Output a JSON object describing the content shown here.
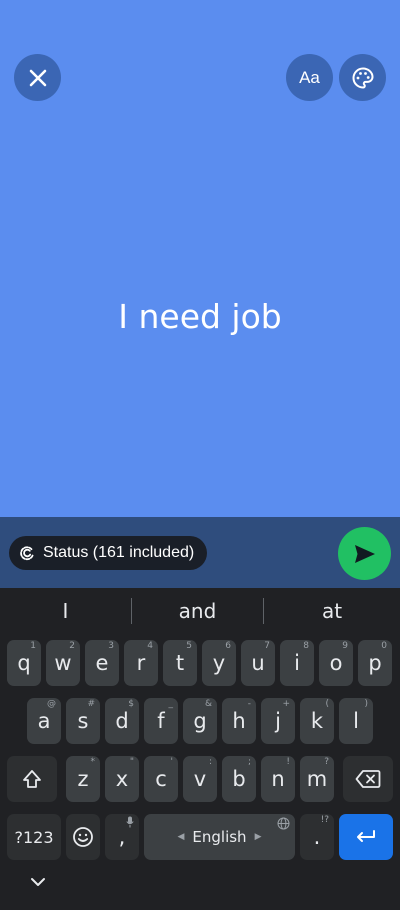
{
  "status_editor": {
    "text": "I need job",
    "background_color": "#5b8def",
    "font_button_label": "Aa",
    "audience_label": "Status (161 included)"
  },
  "icons": {
    "close": "close-icon",
    "palette": "palette-icon",
    "audience": "status-icon",
    "send": "send-icon",
    "shift": "shift-icon",
    "backspace": "backspace-icon",
    "emoji": "emoji-icon",
    "mic": "mic-icon",
    "globe": "globe-icon",
    "enter": "enter-icon",
    "collapse": "chevron-down-icon"
  },
  "keyboard": {
    "suggestions": [
      "I",
      "and",
      "at"
    ],
    "row1": [
      {
        "k": "q",
        "h": "1"
      },
      {
        "k": "w",
        "h": "2"
      },
      {
        "k": "e",
        "h": "3"
      },
      {
        "k": "r",
        "h": "4"
      },
      {
        "k": "t",
        "h": "5"
      },
      {
        "k": "y",
        "h": "6"
      },
      {
        "k": "u",
        "h": "7"
      },
      {
        "k": "i",
        "h": "8"
      },
      {
        "k": "o",
        "h": "9"
      },
      {
        "k": "p",
        "h": "0"
      }
    ],
    "row2": [
      {
        "k": "a",
        "h": "@"
      },
      {
        "k": "s",
        "h": "#"
      },
      {
        "k": "d",
        "h": "$"
      },
      {
        "k": "f",
        "h": "_"
      },
      {
        "k": "g",
        "h": "&"
      },
      {
        "k": "h",
        "h": "-"
      },
      {
        "k": "j",
        "h": "+"
      },
      {
        "k": "k",
        "h": "("
      },
      {
        "k": "l",
        "h": ")"
      }
    ],
    "row3": [
      {
        "k": "z",
        "h": "*"
      },
      {
        "k": "x",
        "h": "\""
      },
      {
        "k": "c",
        "h": "'"
      },
      {
        "k": "v",
        "h": ":"
      },
      {
        "k": "b",
        "h": ";"
      },
      {
        "k": "n",
        "h": "!"
      },
      {
        "k": "m",
        "h": "?"
      }
    ],
    "symbols_label": "?123",
    "comma": ",",
    "space_label": "English",
    "period": ".",
    "period_hint": "!?"
  }
}
